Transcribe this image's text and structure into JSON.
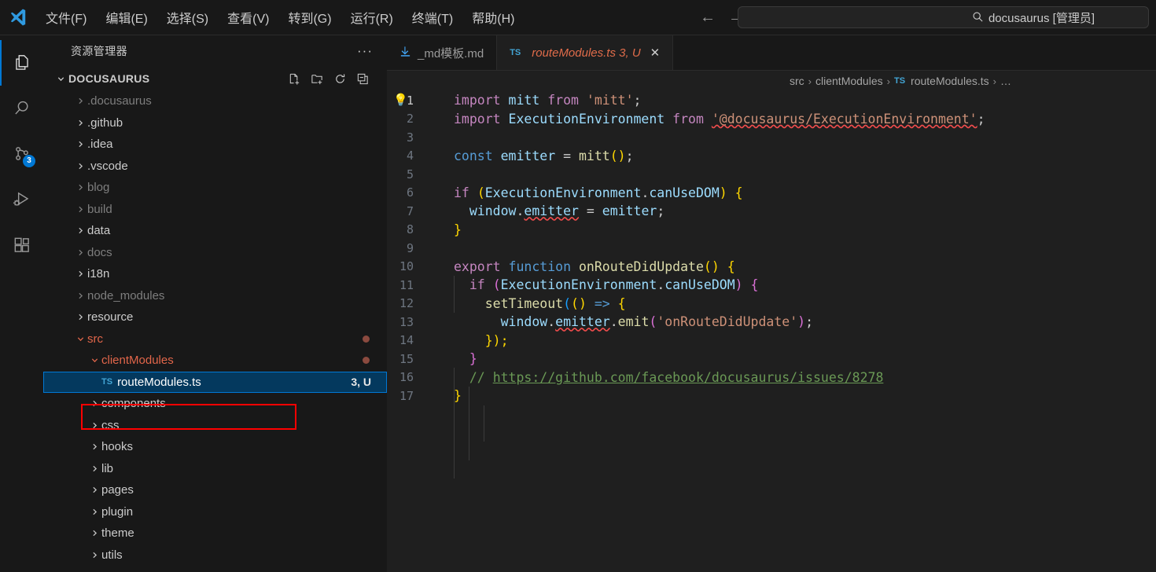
{
  "titlebar": {
    "logo_name": "vscode-logo",
    "menus": [
      {
        "label": "文件(F)",
        "mnemonic": "F"
      },
      {
        "label": "编辑(E)",
        "mnemonic": "E"
      },
      {
        "label": "选择(S)",
        "mnemonic": "S"
      },
      {
        "label": "查看(V)",
        "mnemonic": "V"
      },
      {
        "label": "转到(G)",
        "mnemonic": "G"
      },
      {
        "label": "运行(R)",
        "mnemonic": "R"
      },
      {
        "label": "终端(T)",
        "mnemonic": "T"
      },
      {
        "label": "帮助(H)",
        "mnemonic": "H"
      }
    ],
    "back_arrow": "←",
    "forward_arrow": "→",
    "search_icon": "⌕",
    "search_text": "docusaurus [管理员]"
  },
  "activitybar": {
    "items": [
      {
        "name": "explorer",
        "active": true,
        "badge": ""
      },
      {
        "name": "search",
        "active": false,
        "badge": ""
      },
      {
        "name": "source-control",
        "active": false,
        "badge": "3"
      },
      {
        "name": "run-and-debug",
        "active": false,
        "badge": ""
      },
      {
        "name": "extensions",
        "active": false,
        "badge": ""
      }
    ]
  },
  "sidebar": {
    "title": "资源管理器",
    "more_actions": "···",
    "root": {
      "label": "DOCUSAURUS",
      "expanded": true,
      "chevron": "⌄"
    },
    "actions": [
      {
        "name": "new-file-icon",
        "title": "新建文件"
      },
      {
        "name": "new-folder-icon",
        "title": "新建文件夹"
      },
      {
        "name": "refresh-icon",
        "title": "刷新"
      },
      {
        "name": "collapse-all-icon",
        "title": "全部折叠"
      }
    ],
    "tree": [
      {
        "label": ".docusaurus",
        "indent": 1,
        "expanded": false,
        "state": "dim"
      },
      {
        "label": ".github",
        "indent": 1,
        "expanded": false,
        "state": "normal"
      },
      {
        "label": ".idea",
        "indent": 1,
        "expanded": false,
        "state": "normal"
      },
      {
        "label": ".vscode",
        "indent": 1,
        "expanded": false,
        "state": "normal"
      },
      {
        "label": "blog",
        "indent": 1,
        "expanded": false,
        "state": "dim"
      },
      {
        "label": "build",
        "indent": 1,
        "expanded": false,
        "state": "dim"
      },
      {
        "label": "data",
        "indent": 1,
        "expanded": false,
        "state": "normal"
      },
      {
        "label": "docs",
        "indent": 1,
        "expanded": false,
        "state": "dim"
      },
      {
        "label": "i18n",
        "indent": 1,
        "expanded": false,
        "state": "normal"
      },
      {
        "label": "node_modules",
        "indent": 1,
        "expanded": false,
        "state": "dim"
      },
      {
        "label": "resource",
        "indent": 1,
        "expanded": false,
        "state": "normal"
      },
      {
        "label": "src",
        "indent": 1,
        "expanded": true,
        "state": "modified",
        "dot": true
      },
      {
        "label": "clientModules",
        "indent": 2,
        "expanded": true,
        "state": "modified",
        "dot": true
      },
      {
        "label": "routeModules.ts",
        "indent": 3,
        "file": true,
        "icon": "TS",
        "selected": true,
        "badge": "3, U"
      },
      {
        "label": "components",
        "indent": 2,
        "expanded": false,
        "state": "normal"
      },
      {
        "label": "css",
        "indent": 2,
        "expanded": false,
        "state": "normal"
      },
      {
        "label": "hooks",
        "indent": 2,
        "expanded": false,
        "state": "normal"
      },
      {
        "label": "lib",
        "indent": 2,
        "expanded": false,
        "state": "normal"
      },
      {
        "label": "pages",
        "indent": 2,
        "expanded": false,
        "state": "normal"
      },
      {
        "label": "plugin",
        "indent": 2,
        "expanded": false,
        "state": "normal"
      },
      {
        "label": "theme",
        "indent": 2,
        "expanded": false,
        "state": "normal"
      },
      {
        "label": "utils",
        "indent": 2,
        "expanded": false,
        "state": "normal"
      }
    ],
    "annotation_color": "#ff0000"
  },
  "editor": {
    "tabs": [
      {
        "label": "_md模板.md",
        "icon": "md-download",
        "active": false,
        "dirty": false
      },
      {
        "label": "routeModules.ts 3, U",
        "icon": "TS",
        "active": true,
        "close": "✕"
      }
    ],
    "breadcrumb": [
      "src",
      "clientModules",
      "routeModules.ts",
      "…"
    ],
    "breadcrumb_file_icon": "TS",
    "separator": "›",
    "lightbulb": "💡",
    "lines": [
      {
        "n": "1",
        "current": true
      },
      {
        "n": "2",
        "current": false
      },
      {
        "n": "3",
        "current": false
      },
      {
        "n": "4",
        "current": false
      },
      {
        "n": "5",
        "current": false
      },
      {
        "n": "6",
        "current": false
      },
      {
        "n": "7",
        "current": false
      },
      {
        "n": "8",
        "current": false
      },
      {
        "n": "9",
        "current": false
      },
      {
        "n": "10",
        "current": false
      },
      {
        "n": "11",
        "current": false
      },
      {
        "n": "12",
        "current": false
      },
      {
        "n": "13",
        "current": false
      },
      {
        "n": "14",
        "current": false
      },
      {
        "n": "15",
        "current": false
      },
      {
        "n": "16",
        "current": false
      },
      {
        "n": "17",
        "current": false
      }
    ],
    "code": {
      "l1_import": "import",
      "l1_mitt": "mitt",
      "l1_from": "from",
      "l1_str": "'mitt'",
      "l1_semi": ";",
      "l2_import": "import",
      "l2_name": "ExecutionEnvironment",
      "l2_from": "from",
      "l2_str": "'@docusaurus/ExecutionEnvironment'",
      "l2_semi": ";",
      "l4_const": "const",
      "l4_emitter": "emitter",
      "l4_eq": "=",
      "l4_mitt": "mitt",
      "l4_parens": "()",
      "l4_semi": ";",
      "l6_if": "if",
      "l6_open": "(",
      "l6_obj": "ExecutionEnvironment",
      "l6_dot": ".",
      "l6_prop": "canUseDOM",
      "l6_close": ")",
      "l6_brace": "{",
      "l7_window": "window",
      "l7_dot": ".",
      "l7_emitter": "emitter",
      "l7_eq": "=",
      "l7_val": "emitter",
      "l7_semi": ";",
      "l8_brace": "}",
      "l10_export": "export",
      "l10_function": "function",
      "l10_name": "onRouteDidUpdate",
      "l10_parens": "()",
      "l10_brace": "{",
      "l11_if": "if",
      "l11_open": "(",
      "l11_obj": "ExecutionEnvironment",
      "l11_dot": ".",
      "l11_prop": "canUseDOM",
      "l11_close": ")",
      "l11_brace": "{",
      "l12_fn": "setTimeout",
      "l12_open": "(",
      "l12_inner": "()",
      "l12_arrow": "=>",
      "l12_brace": "{",
      "l13_window": "window",
      "l13_emitter": "emitter",
      "l13_emit": "emit",
      "l13_open": "(",
      "l13_str": "'onRouteDidUpdate'",
      "l13_close": ")",
      "l13_semi": ";",
      "l14_close": "});",
      "l15_brace": "}",
      "l16_comment": "//",
      "l16_url": "https://github.com/facebook/docusaurus/issues/8278",
      "l17_brace": "}"
    }
  },
  "colors": {
    "accent": "#0078d4",
    "selection_bg": "#04395e",
    "modified_fg": "#e2664a",
    "annotation": "#ff0000",
    "editor_bg": "#1f1f1f",
    "chrome_bg": "#181818"
  }
}
